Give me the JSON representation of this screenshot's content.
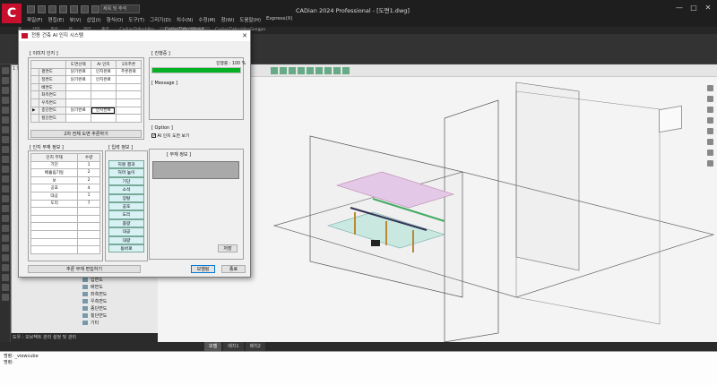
{
  "app": {
    "logo": "C",
    "window_title": "CADian 2024 Professional - [도면1.dwg]",
    "search_placeholder": "제목 및 주석",
    "menus": [
      "파일(F)",
      "편집(E)",
      "뷰(V)",
      "삽입(I)",
      "형식(O)",
      "도구(T)",
      "그리기(D)",
      "치수(N)",
      "수정(M)",
      "창(W)",
      "도움말(H)",
      "Express(X)"
    ],
    "window_controls": [
      "—",
      "□",
      "✕"
    ]
  },
  "ribbon_tabs": [
    "홈",
    "삽입",
    "주석",
    "뷰",
    "관리",
    "출력",
    "CadianTVArchPro",
    "CadianTVArchProkit",
    "CadianTVArchProGongpo"
  ],
  "ribbon_active_tab": "CadianTVArchProkit",
  "layer_list": [
    "평면도",
    "입면도",
    "배면도",
    "좌측면도",
    "우측면도",
    "종단면도",
    "횡단면도",
    "기타"
  ],
  "panel_status": "도우 : 오브젝트 관리 설정 및 관리",
  "panel_title": "1 도면 뷰어",
  "model_tabs": [
    "모델",
    "배치1",
    "배치2"
  ],
  "model_tab_active": "모델",
  "command_lines": [
    "명령: _viewcube",
    "명령:"
  ],
  "dialog": {
    "title": "전동 건축 AI 인지 시스템",
    "close": "✕",
    "ai_group_label": "[ 이미지 인지 ]",
    "ai_table": {
      "headers": [
        "",
        "도면선택",
        "AI 인지",
        "1차추론"
      ],
      "rows": [
        {
          "name": "평면도",
          "c1": "읽기완료",
          "c2": "인지완료",
          "c3": "추론완료",
          "marker": ""
        },
        {
          "name": "정면도",
          "c1": "읽기완료",
          "c2": "인지완료",
          "c3": "",
          "marker": ""
        },
        {
          "name": "배면도",
          "c1": "",
          "c2": "",
          "c3": "",
          "marker": ""
        },
        {
          "name": "좌측면도",
          "c1": "",
          "c2": "",
          "c3": "",
          "marker": ""
        },
        {
          "name": "우측면도",
          "c1": "",
          "c2": "",
          "c3": "",
          "marker": ""
        },
        {
          "name": "종단면도",
          "c1": "읽기완료",
          "c2": "인지완료",
          "c3": "",
          "marker": "▶"
        },
        {
          "name": "횡단면도",
          "c1": "",
          "c2": "",
          "c3": "",
          "marker": ""
        }
      ]
    },
    "infer_button": "2차 전체 도면 추론하기",
    "member_group_label": "[ 인지 부재 정보 ]",
    "member_table": {
      "headers": [
        "인지 부재",
        "수량"
      ],
      "rows": [
        {
          "name": "기단",
          "qty": "1"
        },
        {
          "name": "배흘림기둥",
          "qty": "2"
        },
        {
          "name": "보",
          "qty": "2"
        },
        {
          "name": "공포",
          "qty": "4"
        },
        {
          "name": "대공",
          "qty": "1"
        },
        {
          "name": "도리",
          "qty": "7"
        }
      ],
      "empty_rows": 6
    },
    "input_group_label": "[ 입력 정보 ]",
    "input_items": [
      "지붕 결과",
      "처마 높이",
      "기단",
      "소석",
      "장탈",
      "공포",
      "도리",
      "종량",
      "대공",
      "대량",
      "동바로"
    ],
    "progress_group_label": "[ 진행중 ]",
    "progress_label": "진행률 : 100 %",
    "progress_value": 1.0,
    "message_label": "[ Message ]",
    "option_label": "[ Option ]",
    "option_checkbox": "AI 인지 도면 보기",
    "output_label": "[ 부재 정보 ]",
    "save_button": "저장",
    "modify_button": "추론 부재 편집하기",
    "ok_button": "모델링",
    "cancel_button": "종료",
    "colors": {
      "progress": "#06b025",
      "accent": "#c8102e",
      "input_cell": "#d8f1f4"
    }
  }
}
